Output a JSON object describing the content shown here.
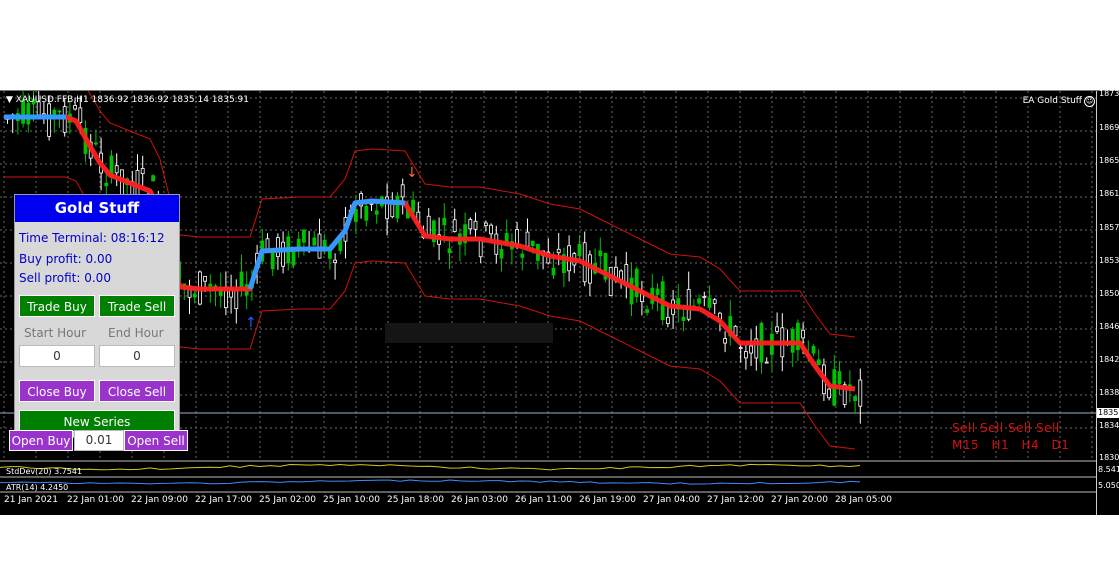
{
  "chart": {
    "symbol_line": "XAUUSD.FFB,H1  1836.92 1836.92 1835.14 1835.91",
    "ea_label": "EA Gold Stuff",
    "price_ticks": [
      "1873",
      "1869",
      "1865",
      "1861",
      "1857",
      "1853",
      "1850",
      "1846",
      "1842",
      "1838",
      "1834",
      "1830"
    ],
    "current_price": "1835",
    "time_ticks": [
      "21 Jan 2021",
      "22 Jan 01:00",
      "22 Jan 09:00",
      "22 Jan 17:00",
      "25 Jan 02:00",
      "25 Jan 10:00",
      "25 Jan 18:00",
      "26 Jan 03:00",
      "26 Jan 11:00",
      "26 Jan 19:00",
      "27 Jan 04:00",
      "27 Jan 12:00",
      "27 Jan 20:00",
      "28 Jan 05:00"
    ],
    "stddev_label": "StdDev(20) 3.7541",
    "stddev_value": "8.541",
    "atr_label": "ATR(14) 4.2450",
    "atr_value": "5.050",
    "signals": {
      "row1": [
        "Sell",
        "Sell",
        "Sell",
        "Sell"
      ],
      "row2": [
        "M15",
        "H1",
        "H4",
        "D1"
      ]
    }
  },
  "panel": {
    "title": "Gold Stuff",
    "time_terminal": "Time Terminal: 08:16:12",
    "buy_profit": "Buy profit: 0.00",
    "sell_profit": "Sell profit: 0.00",
    "trade_buy": "Trade Buy",
    "trade_sell": "Trade Sell",
    "start_hour_label": "Start Hour",
    "end_hour_label": "End Hour",
    "start_hour_value": "0",
    "end_hour_value": "0",
    "close_buy": "Close Buy",
    "close_sell": "Close Sell",
    "new_series": "New Series",
    "open_buy": "Open Buy",
    "lot_value": "0.01",
    "open_sell": "Open Sell"
  },
  "colors": {
    "background": "#000000",
    "bull": "#00c000",
    "bear": "#ffffff",
    "trend_up": "#3399ff",
    "trend_down": "#ff2020",
    "band": "#d01010",
    "panel_title": "#0000f0",
    "button_green": "#008000",
    "button_purple": "#9933cc",
    "signal_text": "#d81010"
  }
}
